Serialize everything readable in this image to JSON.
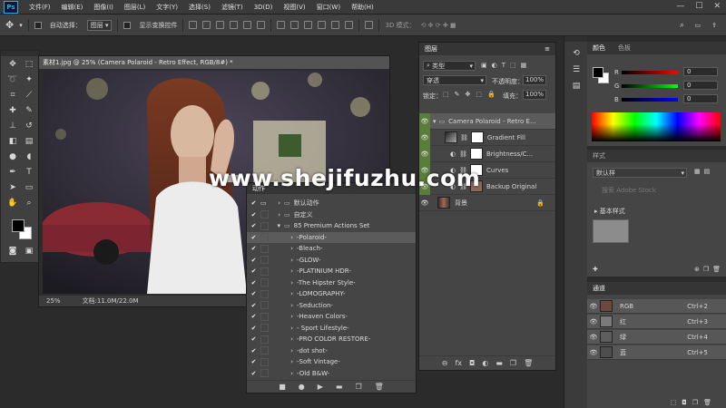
{
  "menu": [
    "文件(F)",
    "编辑(E)",
    "图像(I)",
    "图层(L)",
    "文字(Y)",
    "选择(S)",
    "滤镜(T)",
    "3D(D)",
    "视图(V)",
    "窗口(W)",
    "帮助(H)"
  ],
  "window_controls": [
    "—",
    "☐",
    "✕"
  ],
  "options": {
    "auto_select": "自动选择：",
    "auto_select_value": "图层",
    "show_transform": "显示变换控件",
    "mode_3d": "3D 模式："
  },
  "document": {
    "tab_title": "素材1.jpg @ 25% (Camera Polaroid - Retro Effect, RGB/8#) *",
    "zoom": "25%",
    "doc_size": "文档:11.0M/22.0M"
  },
  "layers_panel": {
    "tab": "图层",
    "filter": "类型",
    "blend_mode": "穿透",
    "opacity_label": "不透明度：",
    "opacity": "100%",
    "lock_label": "锁定：",
    "fill_label": "填充：",
    "fill": "100%",
    "layers": [
      {
        "name": "Camera Polaroid - Retro E..."
      },
      {
        "name": "Gradient Fill"
      },
      {
        "name": "Brightness/C..."
      },
      {
        "name": "Curves"
      },
      {
        "name": "Backup Original"
      },
      {
        "name": "背景"
      }
    ],
    "bottom_buttons": [
      "⊖",
      "fx",
      "◘",
      "◐",
      "▬",
      "❐",
      "🗑"
    ]
  },
  "actions_panel": {
    "tab": "动作",
    "items": [
      {
        "label": "默认动作",
        "level": 0,
        "folder": true
      },
      {
        "label": "自定义",
        "level": 0,
        "folder": true
      },
      {
        "label": "85 Premium Actions Set",
        "level": 0,
        "folder": true,
        "open": true
      },
      {
        "label": "-Polaroid-",
        "level": 1
      },
      {
        "label": "-Bleach-",
        "level": 1
      },
      {
        "label": "-GLOW-",
        "level": 1
      },
      {
        "label": "-PLATINIUM HDR-",
        "level": 1
      },
      {
        "label": "-The Hipster Style-",
        "level": 1
      },
      {
        "label": "-LOMOGRAPHY-",
        "level": 1
      },
      {
        "label": "-Seduction-",
        "level": 1
      },
      {
        "label": "-Heaven Colors-",
        "level": 1
      },
      {
        "label": "- Sport Lifestyle-",
        "level": 1
      },
      {
        "label": "-PRO COLOR RESTORE-",
        "level": 1
      },
      {
        "label": "-dot shot-",
        "level": 1
      },
      {
        "label": "-Soft Vintage-",
        "level": 1
      },
      {
        "label": "-Old B&W-",
        "level": 1
      }
    ],
    "buttons": [
      "■",
      "●",
      "▶",
      "▬",
      "❐",
      "🗑"
    ]
  },
  "color_panel": {
    "tabs": [
      "颜色",
      "色板"
    ],
    "channels": [
      {
        "label": "R",
        "value": "0"
      },
      {
        "label": "G",
        "value": "0"
      },
      {
        "label": "B",
        "value": "0"
      }
    ]
  },
  "styles_panel": {
    "tab": "样式",
    "dropdown": "默认样",
    "search_placeholder": "搜索 Adobe Stock",
    "section": "基本样式"
  },
  "channels_panel": {
    "tab": "通道",
    "rows": [
      {
        "name": "RGB",
        "shortcut": "Ctrl+2"
      },
      {
        "name": "红",
        "shortcut": "Ctrl+3"
      },
      {
        "name": "绿",
        "shortcut": "Ctrl+4"
      },
      {
        "name": "蓝",
        "shortcut": "Ctrl+5"
      }
    ]
  },
  "watermark": "www.shejifuzhu.com",
  "colors": {
    "accent_green": "#5a7d3a",
    "selection": "#5b5b5b",
    "chrome": "#404040"
  }
}
